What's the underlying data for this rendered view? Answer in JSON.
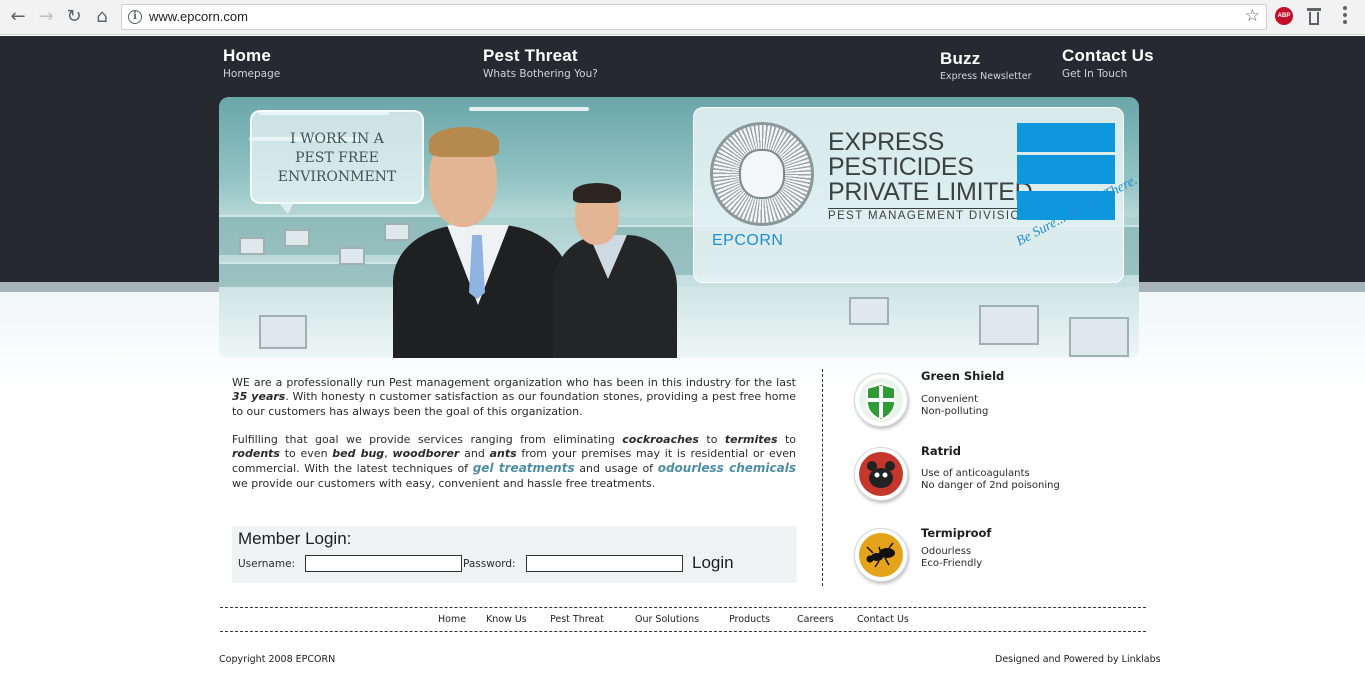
{
  "browser": {
    "url": "www.epcorn.com",
    "adblock_label": "ABP"
  },
  "nav": [
    {
      "title": "Home",
      "subtitle": "Homepage"
    },
    {
      "title": "Pest Threat",
      "subtitle": "Whats Bothering You?"
    },
    {
      "title": "Buzz",
      "subtitle": "Express Newsletter"
    },
    {
      "title": "Contact Us",
      "subtitle": "Get In Touch"
    }
  ],
  "banner": {
    "speech_lines": [
      "I WORK IN A",
      "PEST FREE",
      "ENVIRONMENT"
    ],
    "company_lines": [
      "EXPRESS",
      "PESTICIDES",
      "PRIVATE LIMITED"
    ],
    "division": "PEST MANAGEMENT DIVISION",
    "brand": "EPCORN",
    "tagline": "Be Sure... We are There."
  },
  "intro": {
    "p1_a": "WE are a professionally run Pest management organization who has been in this industry for the last ",
    "p1_years": "35 years",
    "p1_b": ". With honesty n customer satisfaction as our foundation stones, providing a pest free home to our customers has always been the goal of this organization.",
    "p2_a": "Fulfilling that goal we provide services ranging from eliminating ",
    "p2_cockroaches": "cockroaches",
    "p2_to1": " to ",
    "p2_termites": "termites",
    "p2_to2": " to ",
    "p2_rodents": "rodents",
    "p2_b": " to even ",
    "p2_bedbug": "bed bug",
    "p2_comma": ", ",
    "p2_woodborer": "woodborer",
    "p2_and": " and ",
    "p2_ants": "ants",
    "p2_c": " from your premises may it is residential or even commercial. With the latest techniques of ",
    "p2_gel": "gel treatments",
    "p2_d": " and usage of ",
    "p2_odourless": "odourless chemicals",
    "p2_e": " we provide our customers with easy, convenient and hassle free treatments."
  },
  "login": {
    "title": "Member Login:",
    "username_label": "Username:",
    "password_label": "Password:",
    "username_value": "",
    "password_value": "",
    "button": "Login"
  },
  "features": [
    {
      "title": "Green Shield",
      "lines": [
        "Convenient",
        "Non-polluting"
      ],
      "icon": "shield-icon",
      "color": "#2e9b34"
    },
    {
      "title": "Ratrid",
      "lines": [
        "Use of anticoagulants",
        "No danger of 2nd poisoning"
      ],
      "icon": "rat-icon",
      "color": "#c4372a"
    },
    {
      "title": "Termiproof",
      "lines": [
        "Odourless",
        "Eco-Friendly"
      ],
      "icon": "termite-icon",
      "color": "#e5a21b"
    }
  ],
  "footer": {
    "links": [
      "Home",
      "Know Us",
      "Pest Threat",
      "Our Solutions",
      "Products",
      "Careers",
      "Contact Us"
    ],
    "copyright": "Copyright 2008 EPCORN",
    "credit": "Designed and Powered by Linklabs"
  },
  "colors": {
    "header_bg": "#262a30",
    "accent_blue": "#0e97dc",
    "link_teal": "#4d8ea6"
  }
}
